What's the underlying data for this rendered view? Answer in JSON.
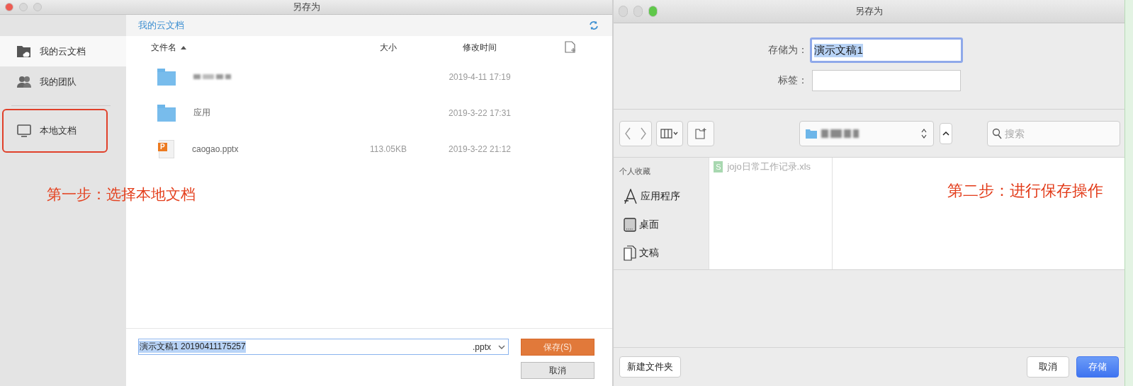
{
  "left_dialog": {
    "title": "另存为",
    "window_controls": [
      {
        "color": "#ee5b52"
      },
      {
        "color": "#d8d8d8"
      },
      {
        "color": "#d8d8d8"
      }
    ],
    "breadcrumb": "我的云文档",
    "sidebar": {
      "items": [
        {
          "label": "我的云文档",
          "selected": true,
          "highlighted": false
        },
        {
          "label": "我的团队",
          "selected": false,
          "highlighted": false
        },
        {
          "label": "本地文档",
          "selected": false,
          "highlighted": true
        }
      ]
    },
    "table": {
      "columns": [
        {
          "label": "文件名",
          "sorted": true
        },
        {
          "label": "大小",
          "sorted": false
        },
        {
          "label": "修改时间",
          "sorted": false
        }
      ],
      "rows": [
        {
          "kind": "folder",
          "blurred": true,
          "modified": "2019-4-11 17:19"
        },
        {
          "kind": "folder",
          "blurred": false,
          "name": "应用",
          "modified": "2019-3-22 17:31"
        },
        {
          "kind": "presentation",
          "blurred": false,
          "icon_letter": "P",
          "name": "caogao.pptx",
          "size": "113.05KB",
          "modified": "2019-3-22 21:12"
        }
      ]
    },
    "filename_field": {
      "value": "演示文稿1 20190411175257",
      "selected": true
    },
    "extension": ".pptx",
    "buttons": [
      {
        "label": "保存(S)",
        "kind": "primary"
      },
      {
        "label": "取消",
        "kind": "secondary"
      }
    ],
    "annotation": "第一步：选择本地文档"
  },
  "right_dialog": {
    "title": "另存为",
    "window_controls": [
      {
        "color": "#d8d8d8"
      },
      {
        "color": "#d8d8d8"
      },
      {
        "color": "#5fc84a"
      }
    ],
    "save_as": {
      "label": "存储为：",
      "value": "演示文稿1",
      "focused": true
    },
    "tags": {
      "label": "标签："
    },
    "location": {
      "blurred": true
    },
    "search": {
      "placeholder": "搜索"
    },
    "sidebar": {
      "heading": "个人收藏",
      "items": [
        {
          "label": "应用程序"
        },
        {
          "label": "桌面"
        },
        {
          "label": "文稿"
        }
      ]
    },
    "files": [
      {
        "name": "jojo日常工作记录.xls",
        "icon_letter": "S",
        "disabled": true
      }
    ],
    "annotation": "第二步：进行保存操作",
    "buttons_left": [
      {
        "label": "新建文件夹"
      }
    ],
    "buttons_right": [
      {
        "label": "取消",
        "kind": "plain"
      },
      {
        "label": "存储",
        "kind": "primary"
      }
    ]
  }
}
